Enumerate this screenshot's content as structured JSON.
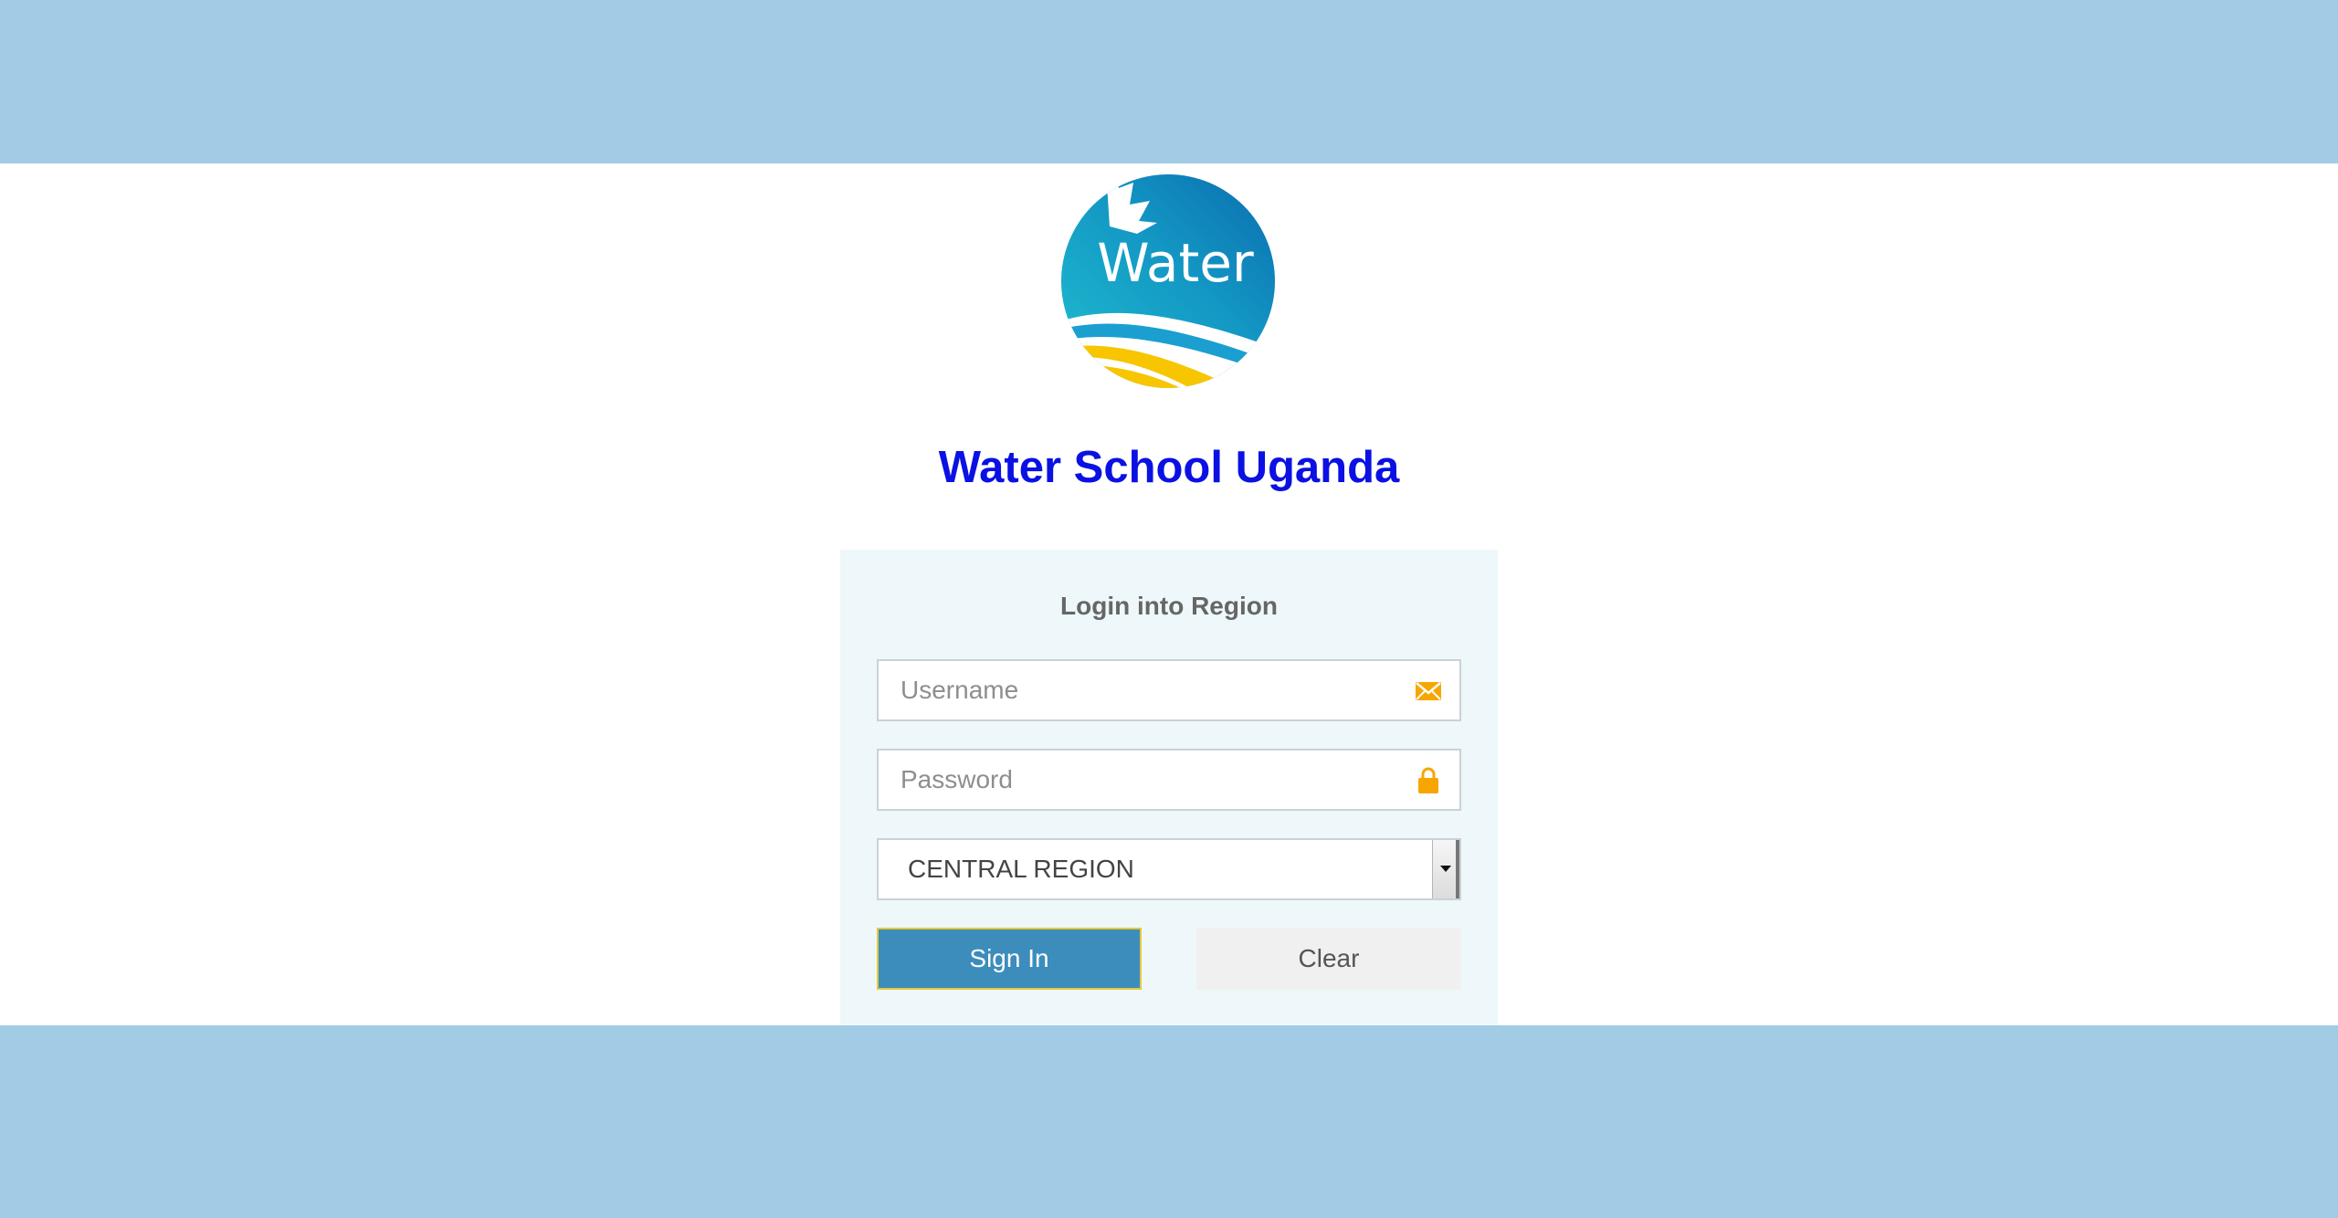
{
  "app": {
    "logo_text": "Water",
    "title": "Water School Uganda"
  },
  "login": {
    "heading": "Login into Region",
    "username_placeholder": "Username",
    "username_icon": "envelope-icon",
    "password_placeholder": "Password",
    "password_icon": "lock-icon",
    "region_selected": "CENTRAL REGION",
    "signin_label": "Sign In",
    "clear_label": "Clear"
  },
  "colors": {
    "band": "#a2cbe5",
    "title": "#0a11e2",
    "panel": "#eef8fa",
    "primary_button": "#3c8dbc",
    "icon_accent": "#f7a600"
  }
}
